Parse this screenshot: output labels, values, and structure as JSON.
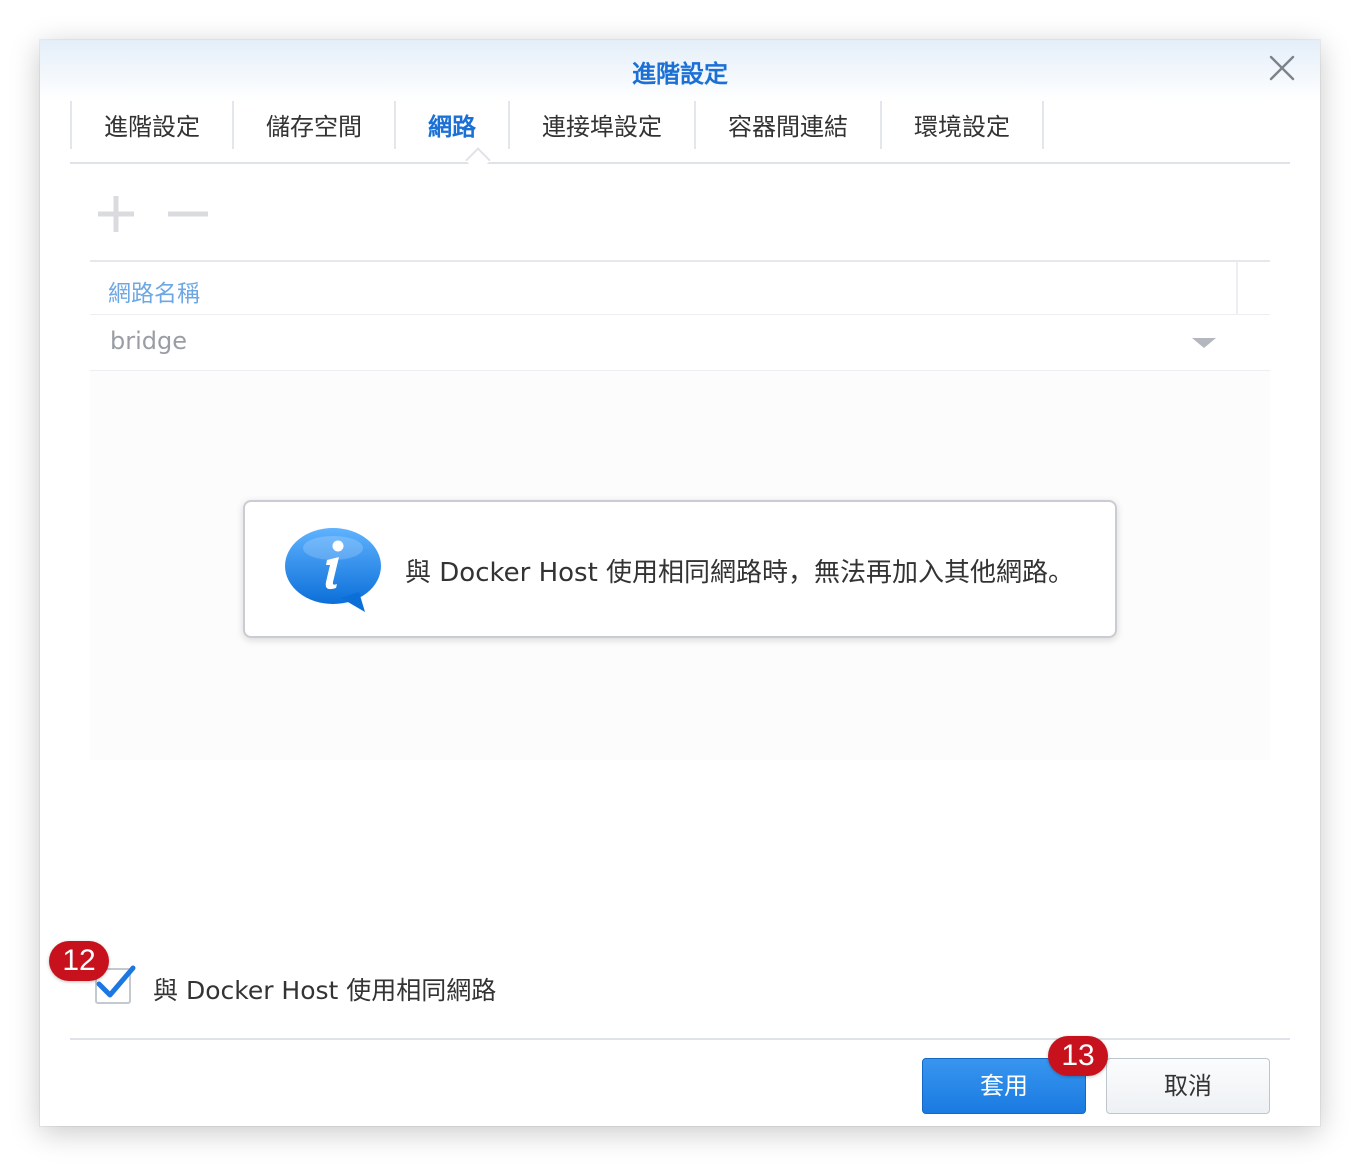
{
  "dialog": {
    "title": "進階設定"
  },
  "tabs": [
    {
      "label": "進階設定"
    },
    {
      "label": "儲存空間"
    },
    {
      "label": "網路",
      "active": true
    },
    {
      "label": "連接埠設定"
    },
    {
      "label": "容器間連結"
    },
    {
      "label": "環境設定"
    }
  ],
  "toolbar": {
    "add_icon": "plus-icon",
    "remove_icon": "minus-icon"
  },
  "grid": {
    "column_header": "網路名稱",
    "rows": [
      {
        "name": "bridge"
      }
    ]
  },
  "info": {
    "icon": "info-speech-bubble-icon",
    "message": "與 Docker Host 使用相同網路時，無法再加入其他網路。"
  },
  "options": {
    "use_host_network_label": "與 Docker Host 使用相同網路",
    "use_host_network_checked": true
  },
  "badges": {
    "checkbox_badge": "12",
    "apply_badge": "13"
  },
  "footer": {
    "apply_label": "套用",
    "cancel_label": "取消"
  },
  "colors": {
    "accent": "#1b70d6",
    "badge": "#c7121d",
    "apply_button": "#1a7ae0"
  }
}
